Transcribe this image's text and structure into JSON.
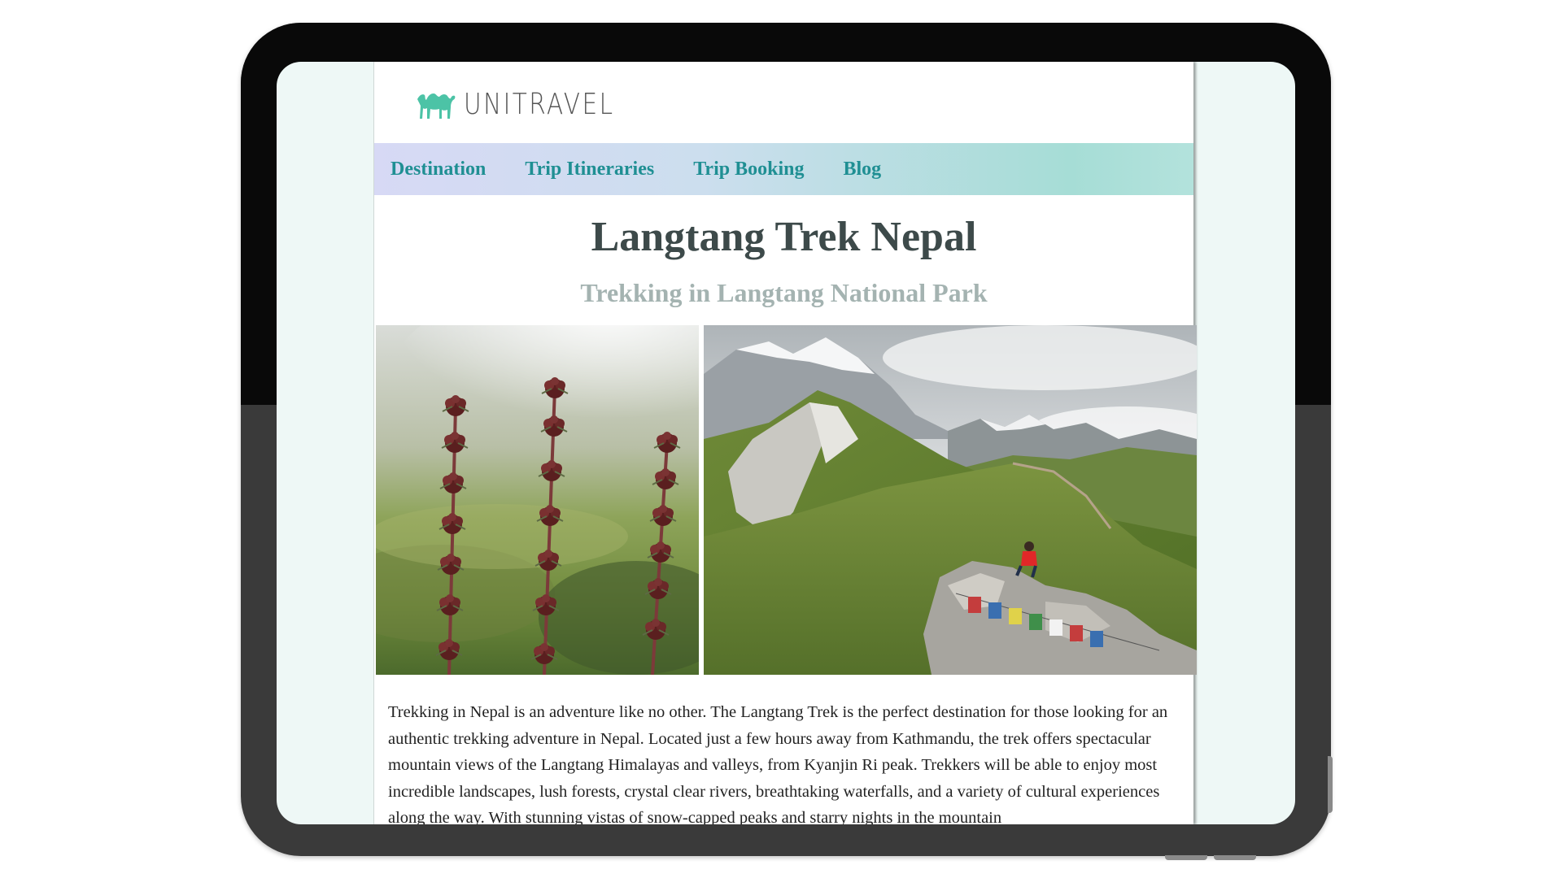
{
  "brand": {
    "name": "UNITRAVEL",
    "accent": "#4cc3a6"
  },
  "nav": {
    "items": [
      {
        "label": "Destination"
      },
      {
        "label": "Trip Itineraries"
      },
      {
        "label": "Trip Booking"
      },
      {
        "label": "Blog"
      }
    ],
    "link_color": "#1f8f93"
  },
  "hero": {
    "title": "Langtang Trek Nepal",
    "subtitle": "Trekking in Langtang National Park"
  },
  "photos": [
    {
      "icon": "flower-stalks-photo"
    },
    {
      "icon": "mountain-ridge-photo"
    }
  ],
  "article": {
    "paragraph": "Trekking in Nepal is an adventure like no other. The Langtang Trek is the perfect destination for those looking for an authentic trekking adventure in Nepal. Located just a few hours away from Kathmandu, the trek offers spectacular mountain views of the Langtang Himalayas and valleys, from Kyanjin Ri peak. Trekkers will be able to enjoy most incredible landscapes, lush forests, crystal clear rivers, breathtaking waterfalls, and a variety of cultural experiences along the way. With stunning vistas of snow-capped peaks and starry nights in the mountain"
  }
}
